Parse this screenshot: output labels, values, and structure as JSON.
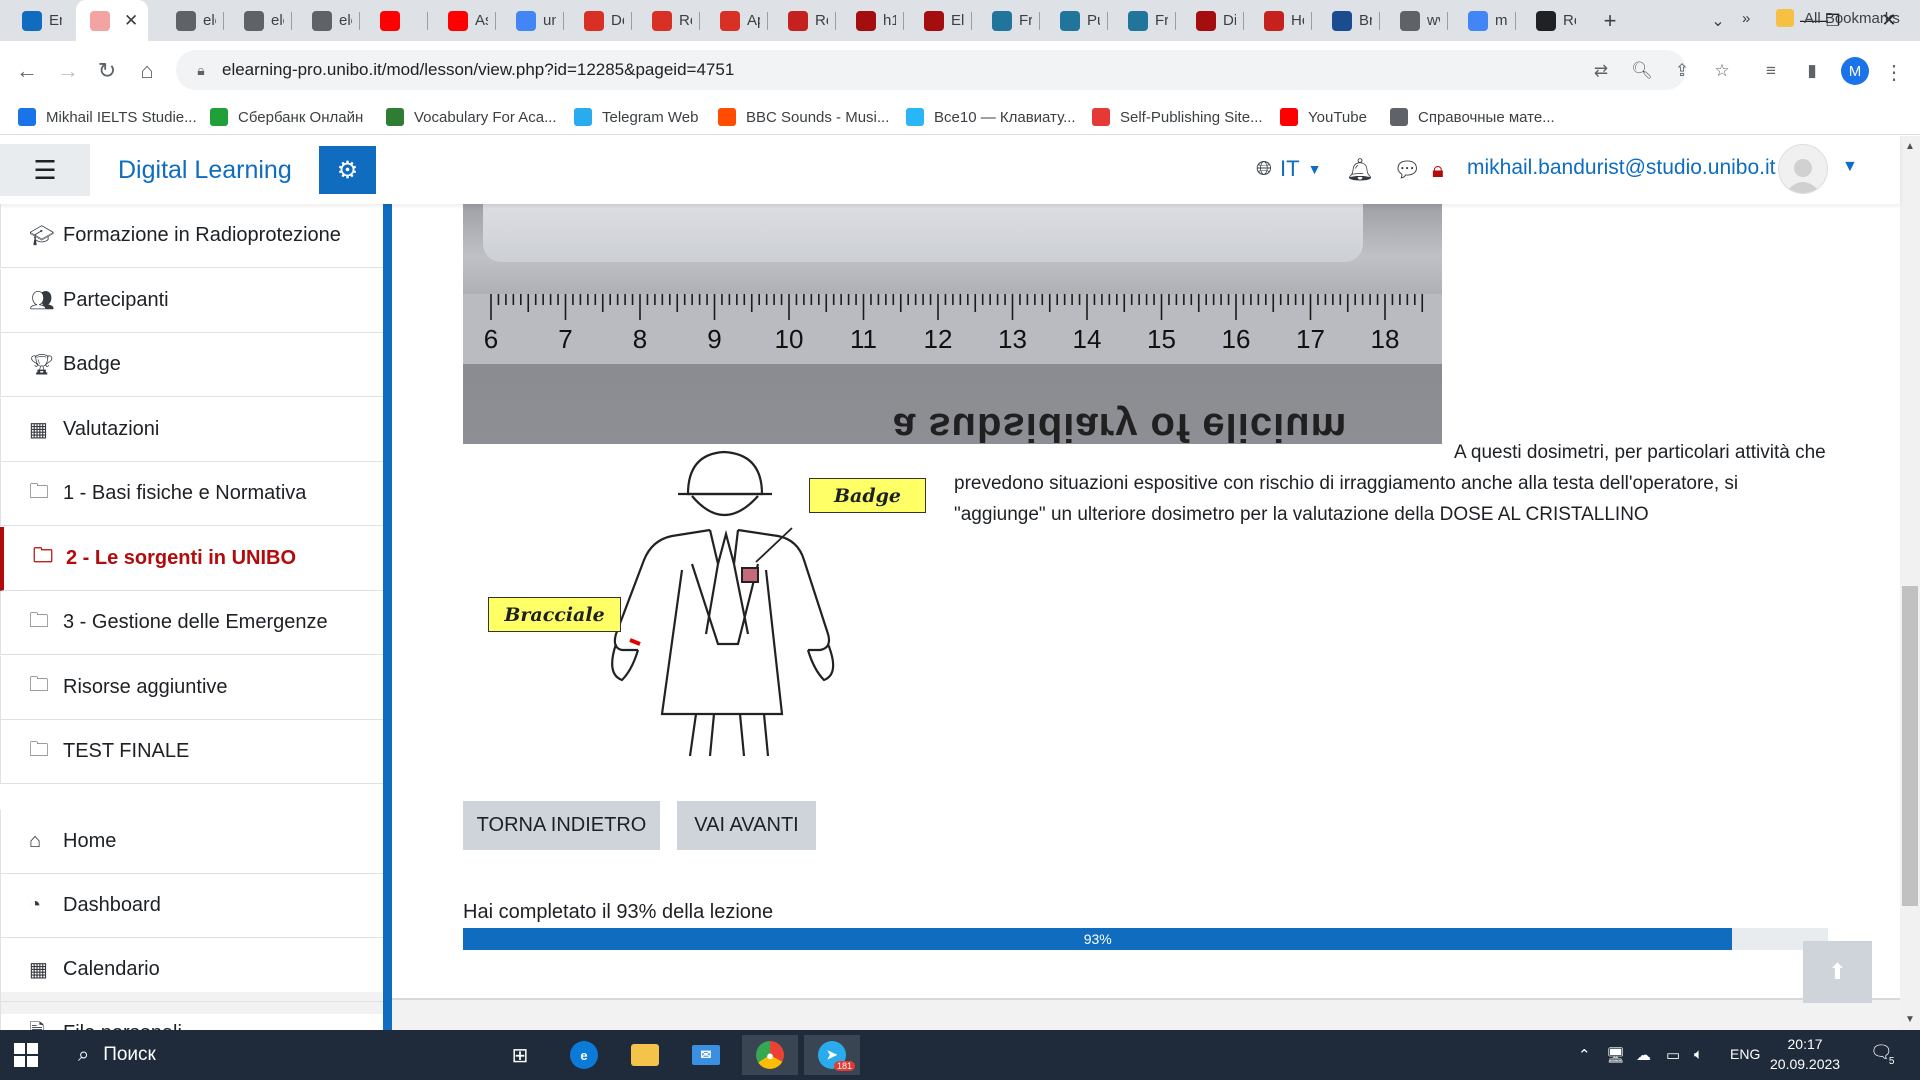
{
  "browser": {
    "tabs": [
      {
        "title": "Em",
        "fav": "outlook-icon",
        "color": "#0f6cbf"
      },
      {
        "title": "",
        "fav": "moodle-icon",
        "color": "#f4a3a3",
        "active": true
      },
      {
        "title": "ele",
        "fav": "globe-icon",
        "color": "#5f6368"
      },
      {
        "title": "ele",
        "fav": "globe-icon",
        "color": "#5f6368"
      },
      {
        "title": "ele",
        "fav": "globe-icon",
        "color": "#5f6368"
      },
      {
        "title": "",
        "fav": "youtube-icon",
        "color": "#ff0000"
      },
      {
        "title": "As",
        "fav": "youtube-icon",
        "color": "#ff0000"
      },
      {
        "title": "un",
        "fav": "google-icon",
        "color": "#4285f4"
      },
      {
        "title": "De",
        "fav": "app-icon",
        "color": "#d93025"
      },
      {
        "title": "Re",
        "fav": "app-icon",
        "color": "#d93025"
      },
      {
        "title": "Ap",
        "fav": "app-icon",
        "color": "#d93025"
      },
      {
        "title": "Re",
        "fav": "research-icon",
        "color": "#c5221f"
      },
      {
        "title": "h1",
        "fav": "shield-icon",
        "color": "#a50e0e"
      },
      {
        "title": "Ele",
        "fav": "shield-icon",
        "color": "#a50e0e"
      },
      {
        "title": "Frc",
        "fav": "wordpress-icon",
        "color": "#21759b"
      },
      {
        "title": "Pu",
        "fav": "wordpress-icon",
        "color": "#21759b"
      },
      {
        "title": "Frc",
        "fav": "wordpress-icon",
        "color": "#21759b"
      },
      {
        "title": "Dip",
        "fav": "shield-icon",
        "color": "#a50e0e"
      },
      {
        "title": "Hc",
        "fav": "app-icon",
        "color": "#c5221f"
      },
      {
        "title": "Bru",
        "fav": "app-icon",
        "color": "#1a4d8f"
      },
      {
        "title": "wv",
        "fav": "globe-icon",
        "color": "#5f6368"
      },
      {
        "title": "ma",
        "fav": "google-icon",
        "color": "#4285f4"
      },
      {
        "title": "Re",
        "fav": "reverso-icon",
        "color": "#202124"
      }
    ],
    "url": "elearning-pro.unibo.it/mod/lesson/view.php?id=12285&pageid=4751",
    "profile_initial": "M",
    "bookmarks": [
      {
        "label": "Mikhail IELTS Studie...",
        "fav": "bookmark-icon",
        "color": "#1a73e8"
      },
      {
        "label": "Сбербанк Онлайн",
        "fav": "sber-icon",
        "color": "#21a038"
      },
      {
        "label": "Vocabulary For Aca...",
        "fav": "ielts-icon",
        "color": "#2e7d32"
      },
      {
        "label": "Telegram Web",
        "fav": "telegram-icon",
        "color": "#2aabee"
      },
      {
        "label": "BBC Sounds - Musi...",
        "fav": "bbc-icon",
        "color": "#ff4c00"
      },
      {
        "label": "Все10 — Клавиату...",
        "fav": "keyboard-icon",
        "color": "#29b6f6"
      },
      {
        "label": "Self-Publishing Site...",
        "fav": "publish-icon",
        "color": "#e53935"
      },
      {
        "label": "YouTube",
        "fav": "youtube-icon",
        "color": "#ff0000"
      },
      {
        "label": "Справочные мате...",
        "fav": "globe-icon",
        "color": "#5f6368"
      }
    ],
    "bookmarks_more": "»",
    "all_bookmarks": "All Bookmarks"
  },
  "navbar": {
    "site_name": "Digital Learning",
    "lang": "IT",
    "user_email": "mikhail.bandurist@studio.unibo.it"
  },
  "drawer": {
    "items": [
      {
        "label": "Formazione in Radioprotezione",
        "icon": "graduation-cap-icon"
      },
      {
        "label": "Partecipanti",
        "icon": "users-icon"
      },
      {
        "label": "Badge",
        "icon": "trophy-icon"
      },
      {
        "label": "Valutazioni",
        "icon": "table-icon"
      },
      {
        "label": "1 - Basi fisiche e Normativa",
        "icon": "folder-icon"
      },
      {
        "label": "2 - Le sorgenti in UNIBO",
        "icon": "folder-icon",
        "active": true
      },
      {
        "label": "3 - Gestione delle Emergenze",
        "icon": "folder-icon"
      },
      {
        "label": "Risorse aggiuntive",
        "icon": "folder-icon"
      },
      {
        "label": "TEST FINALE",
        "icon": "folder-icon"
      }
    ],
    "items2": [
      {
        "label": "Home",
        "icon": "home-icon"
      },
      {
        "label": "Dashboard",
        "icon": "dashboard-icon"
      },
      {
        "label": "Calendario",
        "icon": "calendar-icon"
      },
      {
        "label": "File personali",
        "icon": "file-icon"
      }
    ]
  },
  "lesson": {
    "ruler_numbers": [
      "6",
      "7",
      "8",
      "9",
      "10",
      "11",
      "12",
      "13",
      "14",
      "15",
      "16",
      "17",
      "18"
    ],
    "photo_mirror_text": "a subsidiary of elicium",
    "badge_label": "Badge",
    "bracciale_label": "Bracciale",
    "text": "A questi dosimetri, per particolari attività che prevedono situazioni espositive con rischio di irraggiamento anche alla testa dell'operatore, si \"aggiunge\" un ulteriore dosimetro per la valutazione della DOSE AL CRISTALLINO",
    "btn_back": "TORNA INDIETRO",
    "btn_next": "VAI AVANTI",
    "progress_text": "Hai completato il 93% della lezione",
    "progress_value": 93,
    "progress_label": "93%"
  },
  "taskbar": {
    "search_placeholder": "Поиск",
    "lang": "ENG",
    "time": "20:17",
    "date": "20.09.2023",
    "telegram_badge": "181",
    "notifications": "5"
  }
}
